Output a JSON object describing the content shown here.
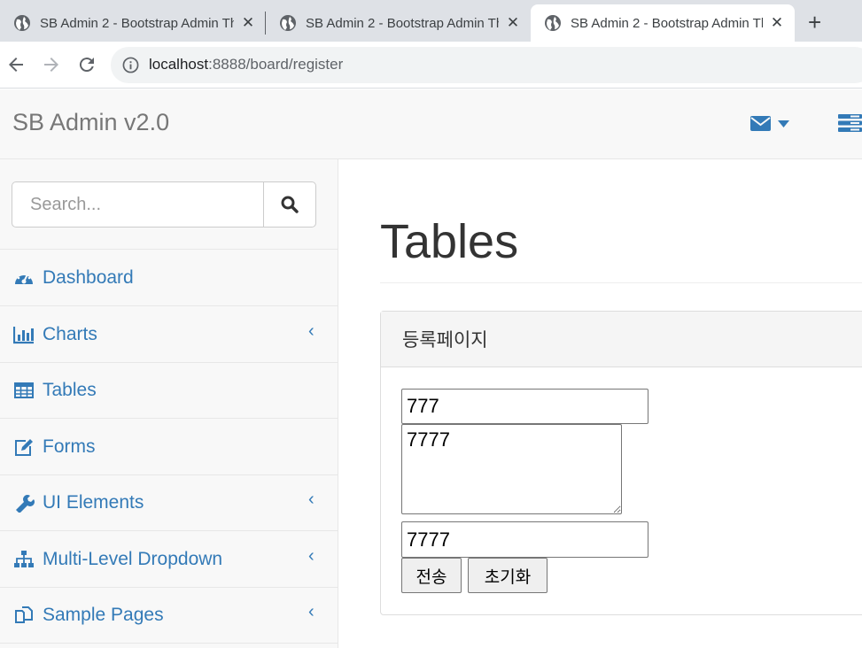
{
  "browser": {
    "tabs": [
      {
        "title": "SB Admin 2 - Bootstrap Admin Theme",
        "close": "✕"
      },
      {
        "title": "SB Admin 2 - Bootstrap Admin Theme",
        "close": "✕"
      },
      {
        "title": "SB Admin 2 - Bootstrap Admin Theme",
        "close": "✕"
      }
    ],
    "new_tab": "+",
    "url_host": "localhost",
    "url_path": ":8888/board/register"
  },
  "navbar": {
    "brand": "SB Admin v2.0"
  },
  "sidebar": {
    "search_placeholder": "Search...",
    "items": [
      {
        "label": "Dashboard",
        "icon": "dashboard-icon",
        "has_arrow": false
      },
      {
        "label": "Charts",
        "icon": "bar-chart-icon",
        "has_arrow": true
      },
      {
        "label": "Tables",
        "icon": "table-icon",
        "has_arrow": false
      },
      {
        "label": "Forms",
        "icon": "edit-icon",
        "has_arrow": false
      },
      {
        "label": "UI Elements",
        "icon": "wrench-icon",
        "has_arrow": true
      },
      {
        "label": "Multi-Level Dropdown",
        "icon": "sitemap-icon",
        "has_arrow": true
      },
      {
        "label": "Sample Pages",
        "icon": "files-icon",
        "has_arrow": true
      }
    ],
    "arrow_glyph": "‹"
  },
  "main": {
    "page_title": "Tables",
    "panel_heading": "등록페이지",
    "form": {
      "title_value": "777",
      "content_value": "7777",
      "writer_value": "7777",
      "submit_label": "전송",
      "reset_label": "초기화"
    }
  },
  "colors": {
    "link": "#337ab7",
    "navbar_bg": "#f8f8f8",
    "tabstrip_bg": "#dee1e6"
  }
}
